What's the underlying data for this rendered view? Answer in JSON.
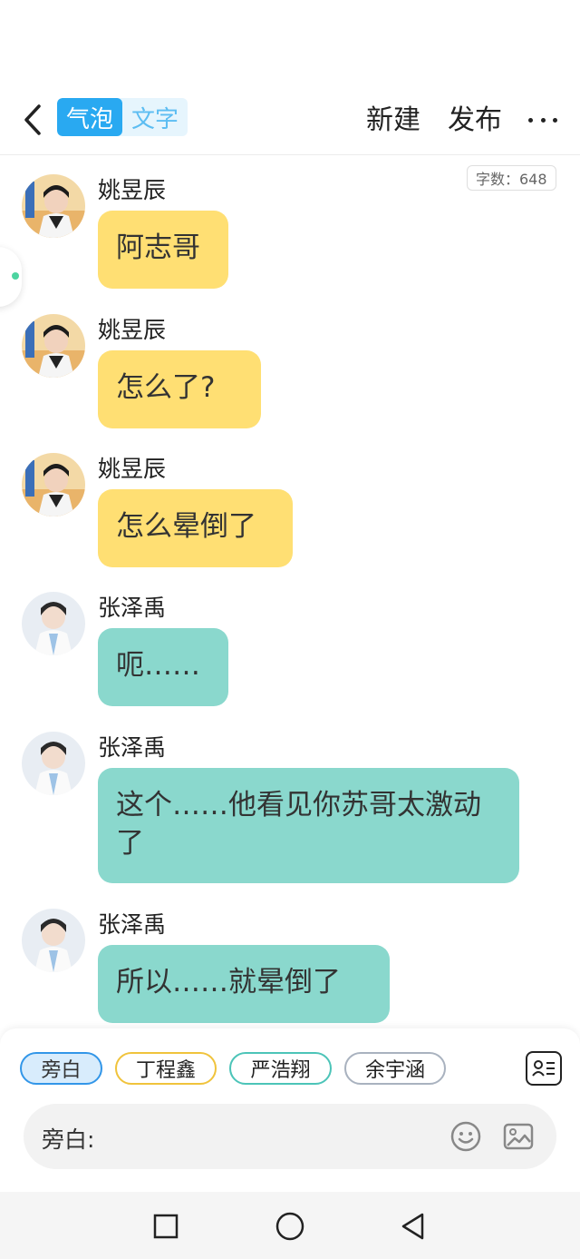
{
  "header": {
    "tabs": [
      {
        "label": "气泡",
        "active": true
      },
      {
        "label": "文字",
        "active": false
      }
    ],
    "new_label": "新建",
    "publish_label": "发布"
  },
  "word_count": "字数：648",
  "messages": [
    {
      "sender": "姚昱辰",
      "text": "阿志哥",
      "color": "yellow"
    },
    {
      "sender": "姚昱辰",
      "text": "怎么了?",
      "color": "yellow"
    },
    {
      "sender": "姚昱辰",
      "text": "怎么晕倒了",
      "color": "yellow"
    },
    {
      "sender": "张泽禹",
      "text": "呃……",
      "color": "teal"
    },
    {
      "sender": "张泽禹",
      "text": "这个……他看见你苏哥太激动了",
      "color": "teal"
    },
    {
      "sender": "张泽禹",
      "text": "所以……就晕倒了",
      "color": "teal"
    }
  ],
  "colors": {
    "yellow_bubble": "#ffdf73",
    "teal_bubble": "#8ad8cd",
    "accent_blue": "#29a9f1"
  },
  "roles": [
    {
      "label": "旁白",
      "color": "#3296e8",
      "selected": true
    },
    {
      "label": "丁程鑫",
      "color": "#f0c33c",
      "selected": false
    },
    {
      "label": "严浩翔",
      "color": "#4cc4b8",
      "selected": false
    },
    {
      "label": "余宇涵",
      "color": "#a9b2bf",
      "selected": false
    }
  ],
  "input": {
    "label": "旁白:",
    "value": ""
  },
  "icons": {
    "back": "chevron-left-icon",
    "more": "more-horizontal-icon",
    "role_card": "contact-card-icon",
    "emoji": "smiley-icon",
    "image": "image-icon",
    "nav_recent": "square-icon",
    "nav_home": "circle-icon",
    "nav_back": "triangle-back-icon"
  }
}
